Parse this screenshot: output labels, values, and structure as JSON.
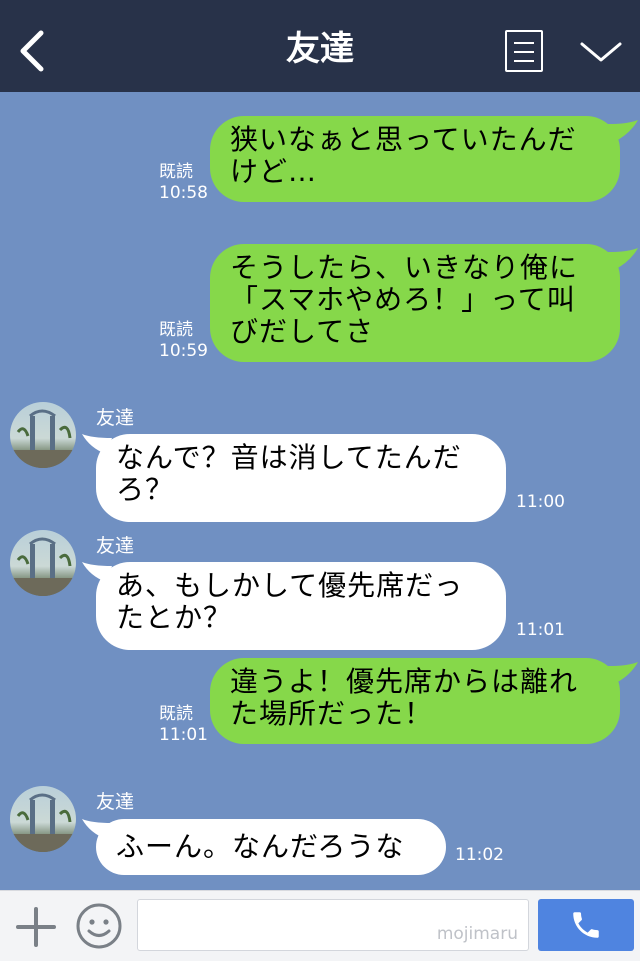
{
  "header": {
    "title": "友達",
    "back_icon": "chevron-left-icon",
    "menu_icon": "menu-icon",
    "collapse_icon": "chevron-down-icon",
    "background": "#283249"
  },
  "chat": {
    "background": "#7090c2",
    "messages": [
      {
        "dir": "out",
        "text": "狭いなぁと思っていたんだ\nけど…",
        "read": "既読",
        "time": "10:58"
      },
      {
        "dir": "out",
        "text": "そうしたら、いきなり俺に\n「スマホやめろ！」って叫\nびだしてさ",
        "read": "既読",
        "time": "10:59"
      },
      {
        "dir": "in",
        "sender": "友達",
        "text": "なんで？音は消してたんだ\nろ？",
        "time": "11:00"
      },
      {
        "dir": "in",
        "sender": "友達",
        "text": "あ、もしかして優先席だっ\nたとか？",
        "time": "11:01"
      },
      {
        "dir": "out",
        "text": "違うよ！優先席からは離れ\nた場所だった！",
        "read": "既読",
        "time": "11:01"
      },
      {
        "dir": "in",
        "sender": "友達",
        "text": "ふーん。なんだろうな",
        "time": "11:02"
      }
    ],
    "colors": {
      "outgoing": "#86d84a",
      "incoming": "#ffffff"
    }
  },
  "footer": {
    "add_icon": "plus-icon",
    "sticker_icon": "smiley-icon",
    "input_value": "",
    "watermark": "mojimaru",
    "call_icon": "phone-icon",
    "call_color": "#4f84e0"
  }
}
